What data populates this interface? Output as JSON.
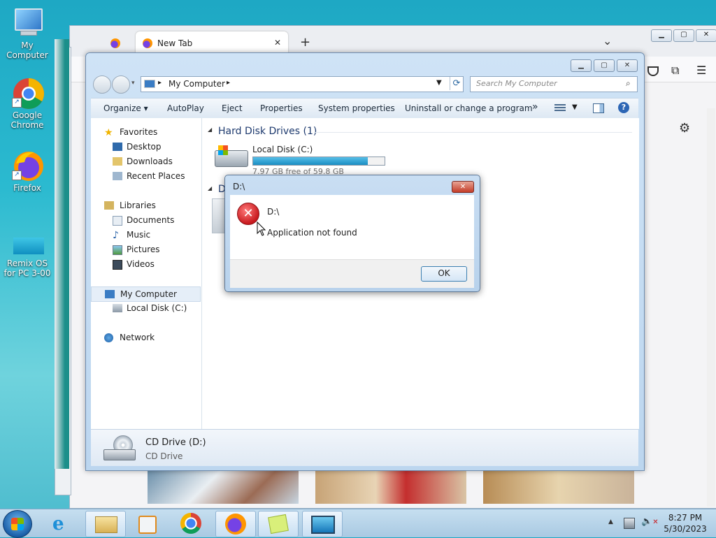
{
  "desktop": {
    "icons": [
      {
        "label": "My Computer"
      },
      {
        "label": "Google Chrome"
      },
      {
        "label": "Firefox"
      },
      {
        "label": "Remix OS for PC 3-00"
      }
    ]
  },
  "browser": {
    "tab_label": "New Tab",
    "new_tab_glyph": "+",
    "tab_close_glyph": "✕",
    "tab_list_glyph": "⌄",
    "menu_glyph": "☰",
    "settings_glyph": "⚙"
  },
  "explorer": {
    "address_segment": "My Computer",
    "search_placeholder": "Search My Computer",
    "toolbar": {
      "organize": "Organize",
      "autoplay": "AutoPlay",
      "eject": "Eject",
      "properties": "Properties",
      "system_properties": "System properties",
      "uninstall": "Uninstall or change a program",
      "more": "»"
    },
    "nav": {
      "favorites": "Favorites",
      "desktop": "Desktop",
      "downloads": "Downloads",
      "recent_places": "Recent Places",
      "libraries": "Libraries",
      "documents": "Documents",
      "music": "Music",
      "pictures": "Pictures",
      "videos": "Videos",
      "my_computer": "My Computer",
      "local_disk": "Local Disk (C:)",
      "network": "Network"
    },
    "group_hdd": "Hard Disk Drives (1)",
    "group_removable_initial": "D",
    "drive_c": {
      "name": "Local Disk (C:)",
      "free": "7.97 GB free of 59.8 GB",
      "used_fraction": 0.87
    },
    "details": {
      "name": "CD Drive (D:)",
      "type": "CD Drive"
    }
  },
  "dialog": {
    "title": "D:\\",
    "path": "D:\\",
    "message": "Application not found",
    "ok_label": "OK",
    "close_glyph": "✕"
  },
  "taskbar": {
    "time": "8:27 PM",
    "date": "5/30/2023",
    "tray_arrow": "▲"
  },
  "colors": {
    "progress": "#27a0d0",
    "error": "#c8191e",
    "accent": "#3c7fb1"
  }
}
